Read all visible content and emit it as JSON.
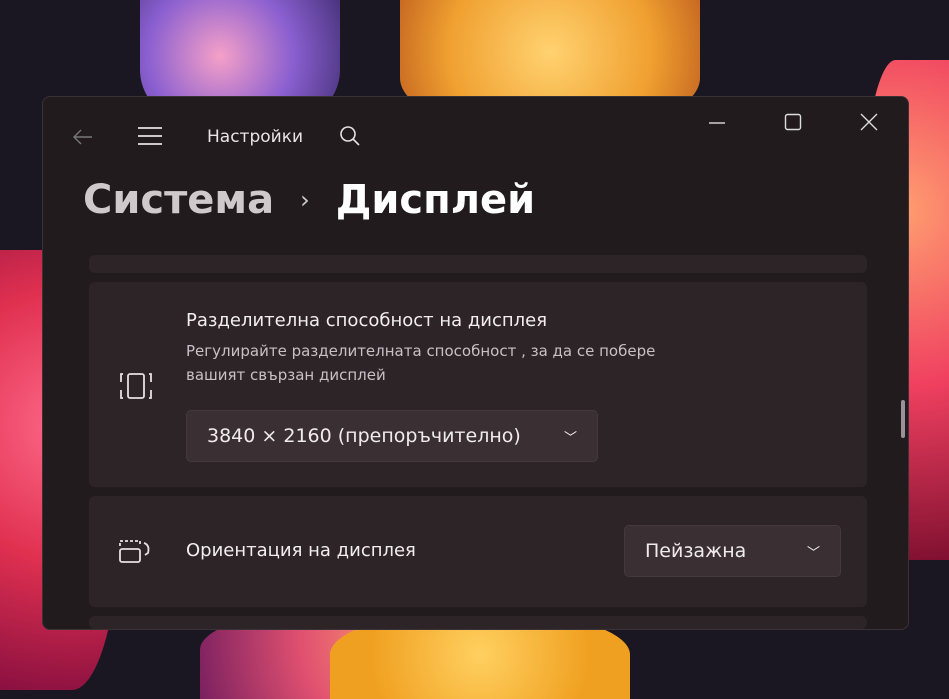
{
  "window": {
    "app_title": "Настройки"
  },
  "breadcrumb": {
    "parent": "Система",
    "current": "Дисплей"
  },
  "resolution": {
    "title": "Разделителна способност на дисплея",
    "description": "Регулирайте разделителната способност , за да се побере вашият свързан дисплей",
    "value": "3840 × 2160 (препоръчително)"
  },
  "orientation": {
    "title": "Ориентация на дисплея",
    "value": "Пейзажна"
  }
}
